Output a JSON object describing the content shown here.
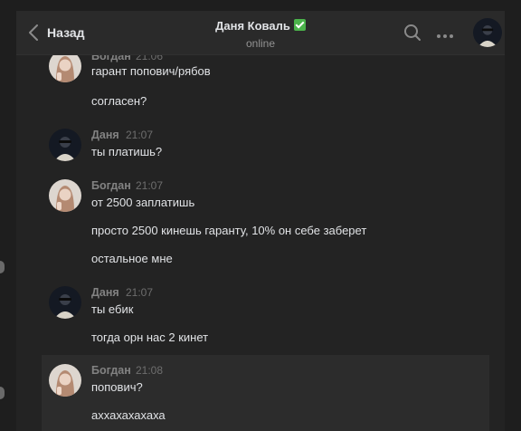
{
  "header": {
    "back_label": "Назад",
    "peer_name": "Даня Коваль",
    "peer_status": "online"
  },
  "colors": {
    "background": "#1e1e1e",
    "panel": "#232323",
    "header": "#2a2a2a",
    "selected_message": "#2c2c2c",
    "verified_badge": "#4bb34b",
    "text": "#e1e3e6",
    "author": "#828282",
    "muted": "#939393"
  },
  "messages": [
    {
      "author": "Богдан",
      "time": "21:06",
      "lines": [
        "гарант попович/рябов",
        "согласен?"
      ]
    },
    {
      "author": "Даня",
      "time": "21:07",
      "lines": [
        "ты платишь?"
      ]
    },
    {
      "author": "Богдан",
      "time": "21:07",
      "lines": [
        "от 2500 заплатишь",
        "просто 2500 кинешь гаранту, 10% он себе заберет",
        "остальное мне"
      ]
    },
    {
      "author": "Даня",
      "time": "21:07",
      "lines": [
        "ты ебик",
        "тогда орн нас 2 кинет"
      ]
    },
    {
      "author": "Богдан",
      "time": "21:08",
      "lines": [
        "попович?",
        "аххахахахаха"
      ]
    }
  ]
}
